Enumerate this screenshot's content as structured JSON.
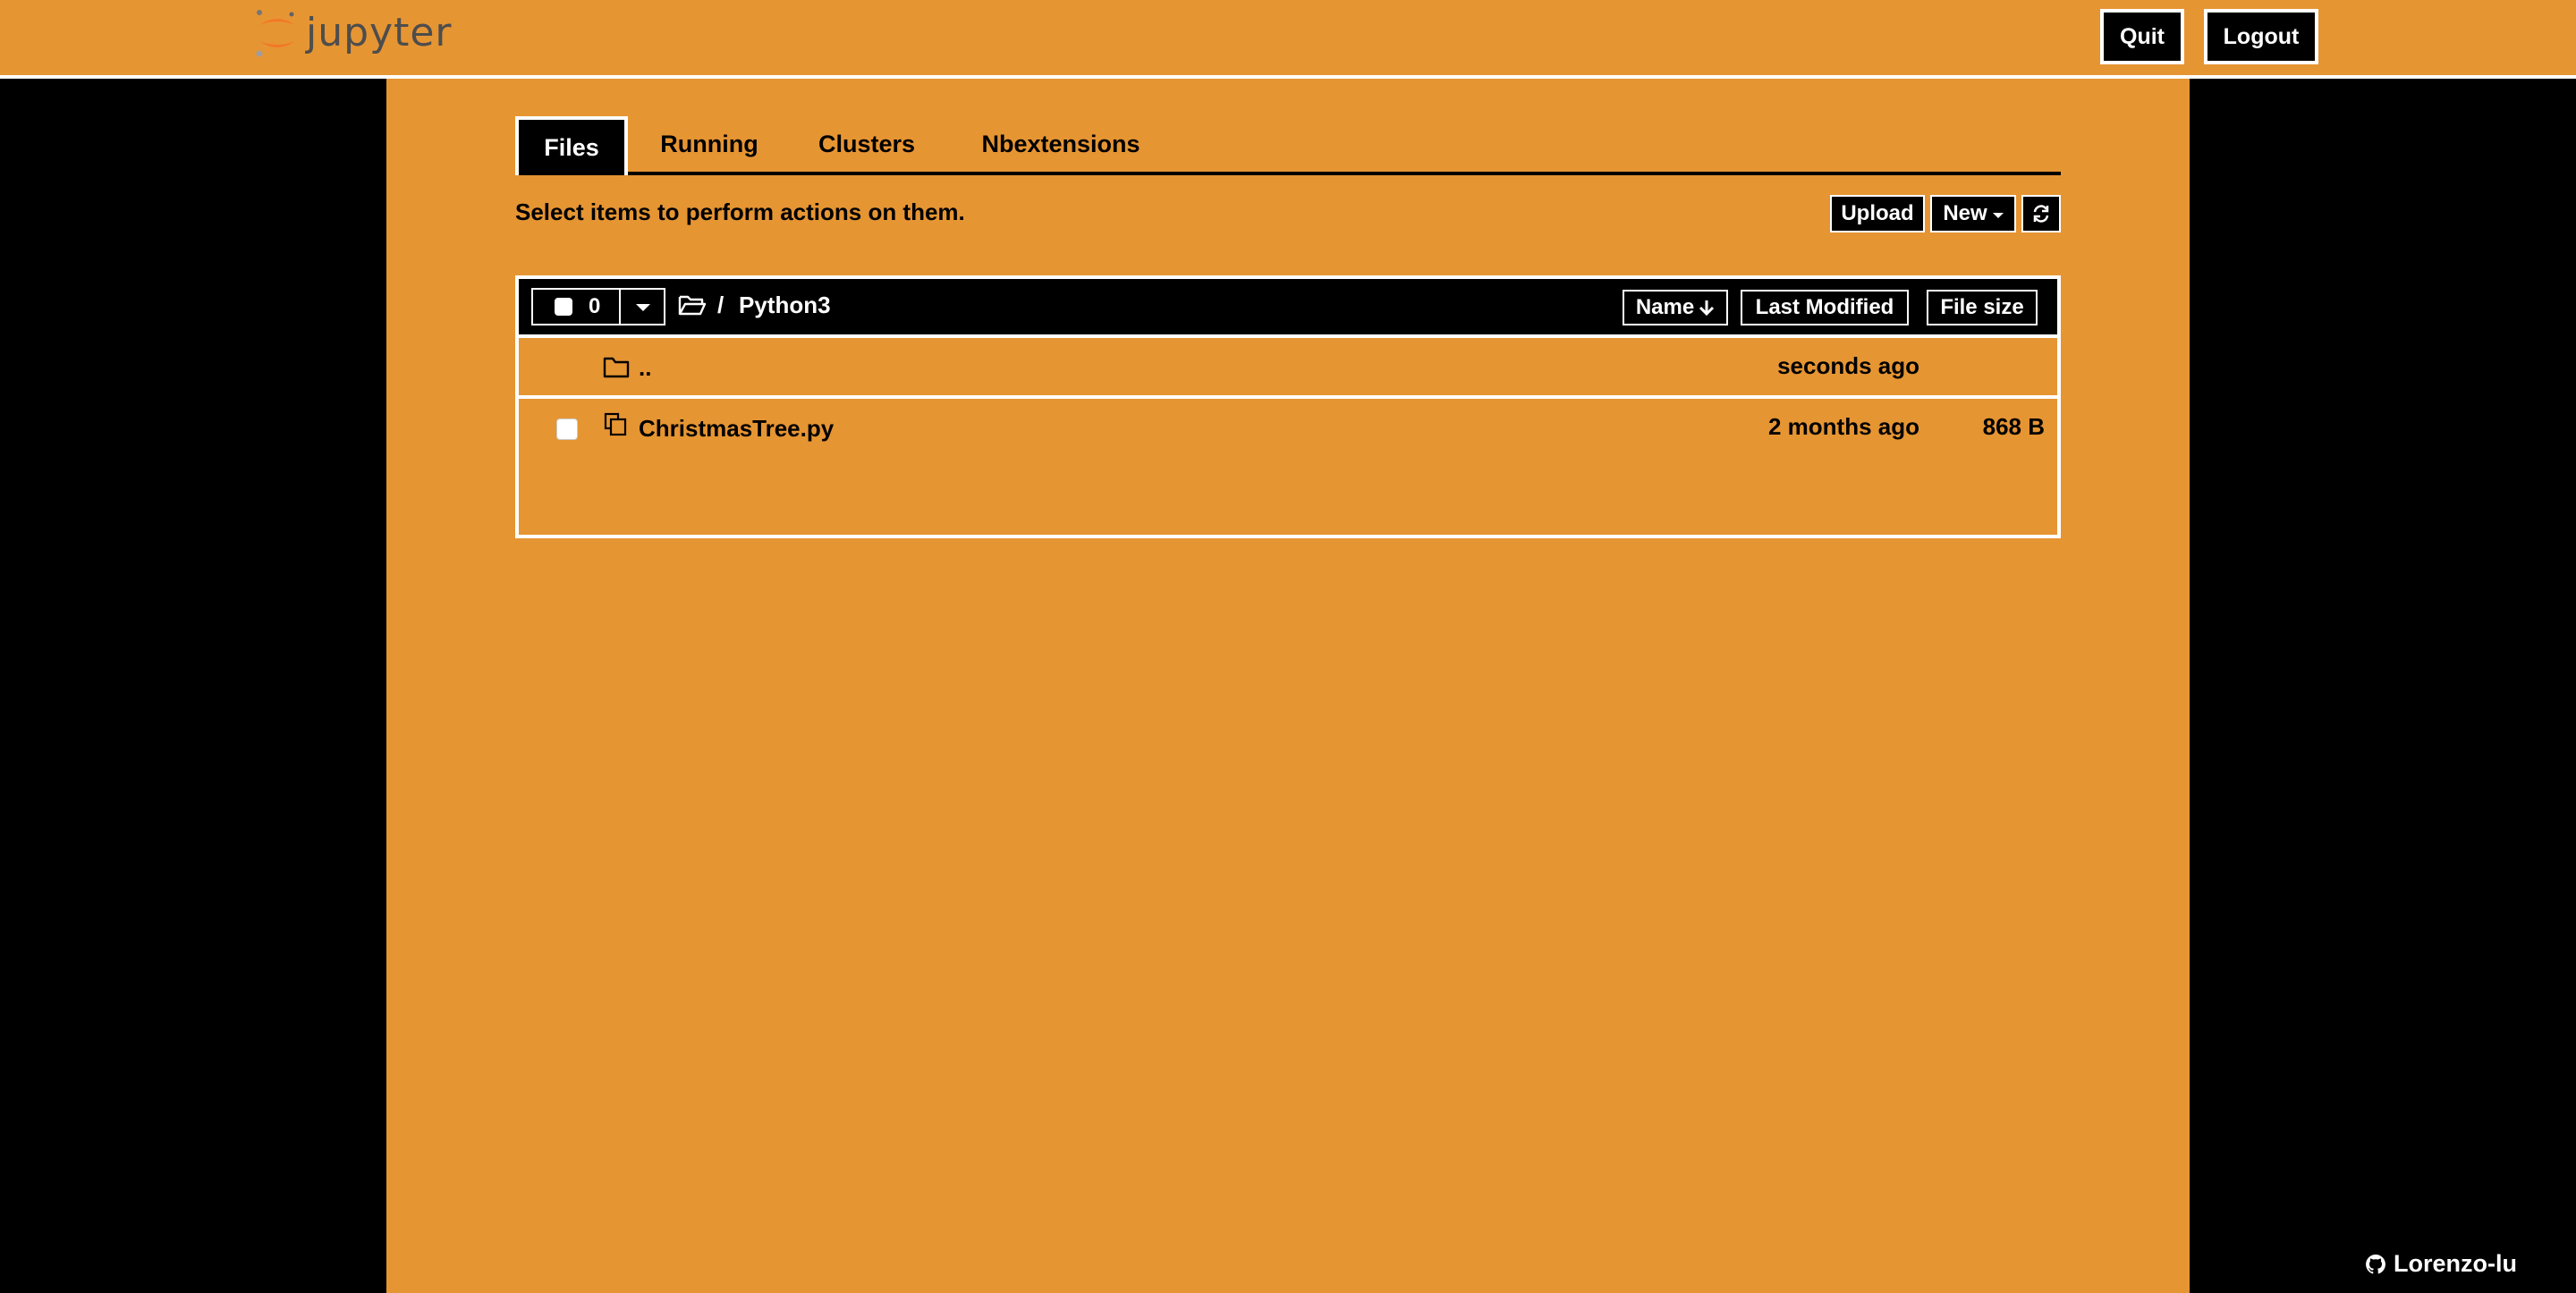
{
  "header": {
    "logo_text": "jupyter",
    "quit_label": "Quit",
    "logout_label": "Logout"
  },
  "tabs": [
    {
      "label": "Files",
      "active": true
    },
    {
      "label": "Running",
      "active": false
    },
    {
      "label": "Clusters",
      "active": false
    },
    {
      "label": "Nbextensions",
      "active": false
    }
  ],
  "toolbar": {
    "hint": "Select items to perform actions on them.",
    "upload_label": "Upload",
    "new_label": "New",
    "refresh_icon": "refresh-icon"
  },
  "filelist": {
    "selected_count": "0",
    "breadcrumb_sep": "/",
    "current_dir": "Python3",
    "sort_name_label": "Name",
    "sort_modified_label": "Last Modified",
    "sort_size_label": "File size",
    "rows": [
      {
        "type": "folder",
        "name": "..",
        "modified": "seconds ago",
        "size": ""
      },
      {
        "type": "file",
        "name": "ChristmasTree.py",
        "modified": "2 months ago",
        "size": "868 B"
      }
    ]
  },
  "footer": {
    "github_user": "Lorenzo-lu"
  },
  "colors": {
    "theme_orange": "#e69533",
    "background": "#000000",
    "text": "#000000",
    "inverse_text": "#ffffff"
  }
}
